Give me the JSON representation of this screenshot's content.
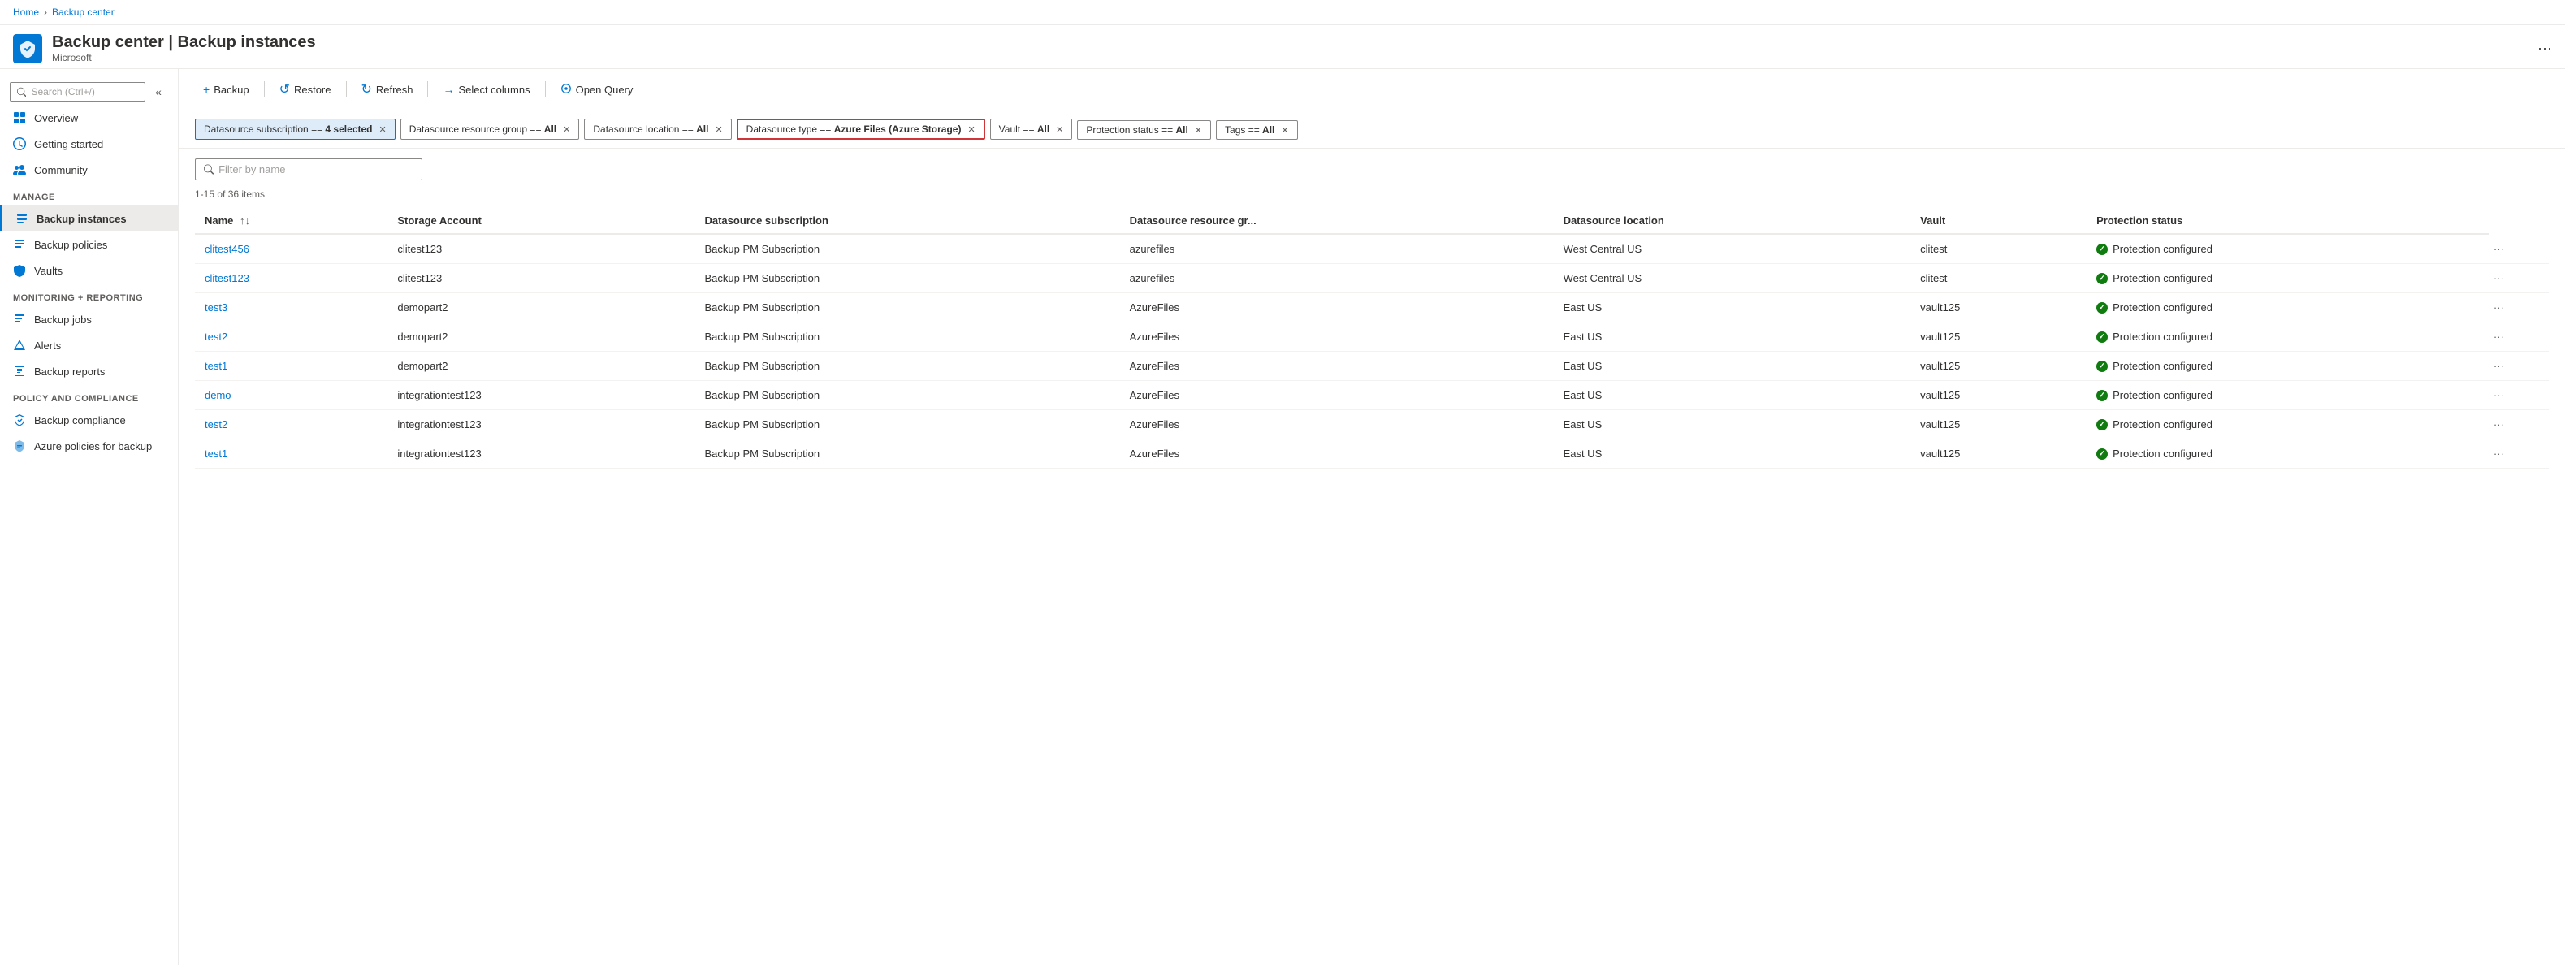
{
  "breadcrumb": {
    "home": "Home",
    "separator": ">",
    "current": "Backup center"
  },
  "header": {
    "title": "Backup center | Backup instances",
    "subtitle": "Microsoft",
    "more_label": "···"
  },
  "sidebar": {
    "search_placeholder": "Search (Ctrl+/)",
    "collapse_label": "«",
    "nav_items": [
      {
        "id": "overview",
        "label": "Overview",
        "icon": "grid"
      },
      {
        "id": "getting-started",
        "label": "Getting started",
        "icon": "flag"
      },
      {
        "id": "community",
        "label": "Community",
        "icon": "people"
      }
    ],
    "sections": [
      {
        "label": "Manage",
        "items": [
          {
            "id": "backup-instances",
            "label": "Backup instances",
            "icon": "backup",
            "active": true
          },
          {
            "id": "backup-policies",
            "label": "Backup policies",
            "icon": "policy"
          },
          {
            "id": "vaults",
            "label": "Vaults",
            "icon": "vault"
          }
        ]
      },
      {
        "label": "Monitoring + reporting",
        "items": [
          {
            "id": "backup-jobs",
            "label": "Backup jobs",
            "icon": "jobs"
          },
          {
            "id": "alerts",
            "label": "Alerts",
            "icon": "alert"
          },
          {
            "id": "backup-reports",
            "label": "Backup reports",
            "icon": "report"
          }
        ]
      },
      {
        "label": "Policy and compliance",
        "items": [
          {
            "id": "backup-compliance",
            "label": "Backup compliance",
            "icon": "compliance"
          },
          {
            "id": "azure-policies",
            "label": "Azure policies for backup",
            "icon": "azure-policy"
          }
        ]
      }
    ]
  },
  "toolbar": {
    "buttons": [
      {
        "id": "backup",
        "label": "Backup",
        "icon": "+"
      },
      {
        "id": "restore",
        "label": "Restore",
        "icon": "↺"
      },
      {
        "id": "refresh",
        "label": "Refresh",
        "icon": "↻"
      },
      {
        "id": "select-columns",
        "label": "Select columns",
        "icon": "→"
      },
      {
        "id": "open-query",
        "label": "Open Query",
        "icon": "◎"
      }
    ]
  },
  "filters": [
    {
      "id": "datasource-subscription",
      "label": "Datasource subscription == ",
      "value": "4 selected",
      "active": true,
      "highlighted": false
    },
    {
      "id": "datasource-resource-group",
      "label": "Datasource resource group == ",
      "value": "All",
      "active": false,
      "highlighted": false
    },
    {
      "id": "datasource-location",
      "label": "Datasource location == ",
      "value": "All",
      "active": false,
      "highlighted": false
    },
    {
      "id": "datasource-type",
      "label": "Datasource type == ",
      "value": "Azure Files (Azure Storage)",
      "active": false,
      "highlighted": true
    },
    {
      "id": "vault",
      "label": "Vault == ",
      "value": "All",
      "active": false,
      "highlighted": false
    },
    {
      "id": "protection-status",
      "label": "Protection status == ",
      "value": "All",
      "active": false,
      "highlighted": false
    },
    {
      "id": "tags",
      "label": "Tags == ",
      "value": "All",
      "active": false,
      "highlighted": false
    }
  ],
  "table": {
    "filter_placeholder": "Filter by name",
    "items_count": "1-15 of 36 items",
    "columns": [
      {
        "id": "name",
        "label": "Name",
        "sortable": true
      },
      {
        "id": "storage-account",
        "label": "Storage Account"
      },
      {
        "id": "datasource-subscription",
        "label": "Datasource subscription"
      },
      {
        "id": "datasource-resource-group",
        "label": "Datasource resource gr..."
      },
      {
        "id": "datasource-location",
        "label": "Datasource location"
      },
      {
        "id": "vault",
        "label": "Vault"
      },
      {
        "id": "protection-status",
        "label": "Protection status"
      }
    ],
    "rows": [
      {
        "name": "clitest456",
        "storage_account": "clitest123",
        "subscription": "Backup PM Subscription",
        "resource_group": "azurefiles",
        "location": "West Central US",
        "vault": "clitest",
        "status": "Protection configured"
      },
      {
        "name": "clitest123",
        "storage_account": "clitest123",
        "subscription": "Backup PM Subscription",
        "resource_group": "azurefiles",
        "location": "West Central US",
        "vault": "clitest",
        "status": "Protection configured"
      },
      {
        "name": "test3",
        "storage_account": "demopart2",
        "subscription": "Backup PM Subscription",
        "resource_group": "AzureFiles",
        "location": "East US",
        "vault": "vault125",
        "status": "Protection configured"
      },
      {
        "name": "test2",
        "storage_account": "demopart2",
        "subscription": "Backup PM Subscription",
        "resource_group": "AzureFiles",
        "location": "East US",
        "vault": "vault125",
        "status": "Protection configured"
      },
      {
        "name": "test1",
        "storage_account": "demopart2",
        "subscription": "Backup PM Subscription",
        "resource_group": "AzureFiles",
        "location": "East US",
        "vault": "vault125",
        "status": "Protection configured"
      },
      {
        "name": "demo",
        "storage_account": "integrationtest123",
        "subscription": "Backup PM Subscription",
        "resource_group": "AzureFiles",
        "location": "East US",
        "vault": "vault125",
        "status": "Protection configured"
      },
      {
        "name": "test2",
        "storage_account": "integrationtest123",
        "subscription": "Backup PM Subscription",
        "resource_group": "AzureFiles",
        "location": "East US",
        "vault": "vault125",
        "status": "Protection configured"
      },
      {
        "name": "test1",
        "storage_account": "integrationtest123",
        "subscription": "Backup PM Subscription",
        "resource_group": "AzureFiles",
        "location": "East US",
        "vault": "vault125",
        "status": "Protection configured"
      }
    ]
  },
  "colors": {
    "accent": "#0078d4",
    "active_bg": "#edebe9",
    "filter_active_bg": "#deecf9",
    "status_green": "#107c10",
    "highlight_red": "#d13438"
  }
}
